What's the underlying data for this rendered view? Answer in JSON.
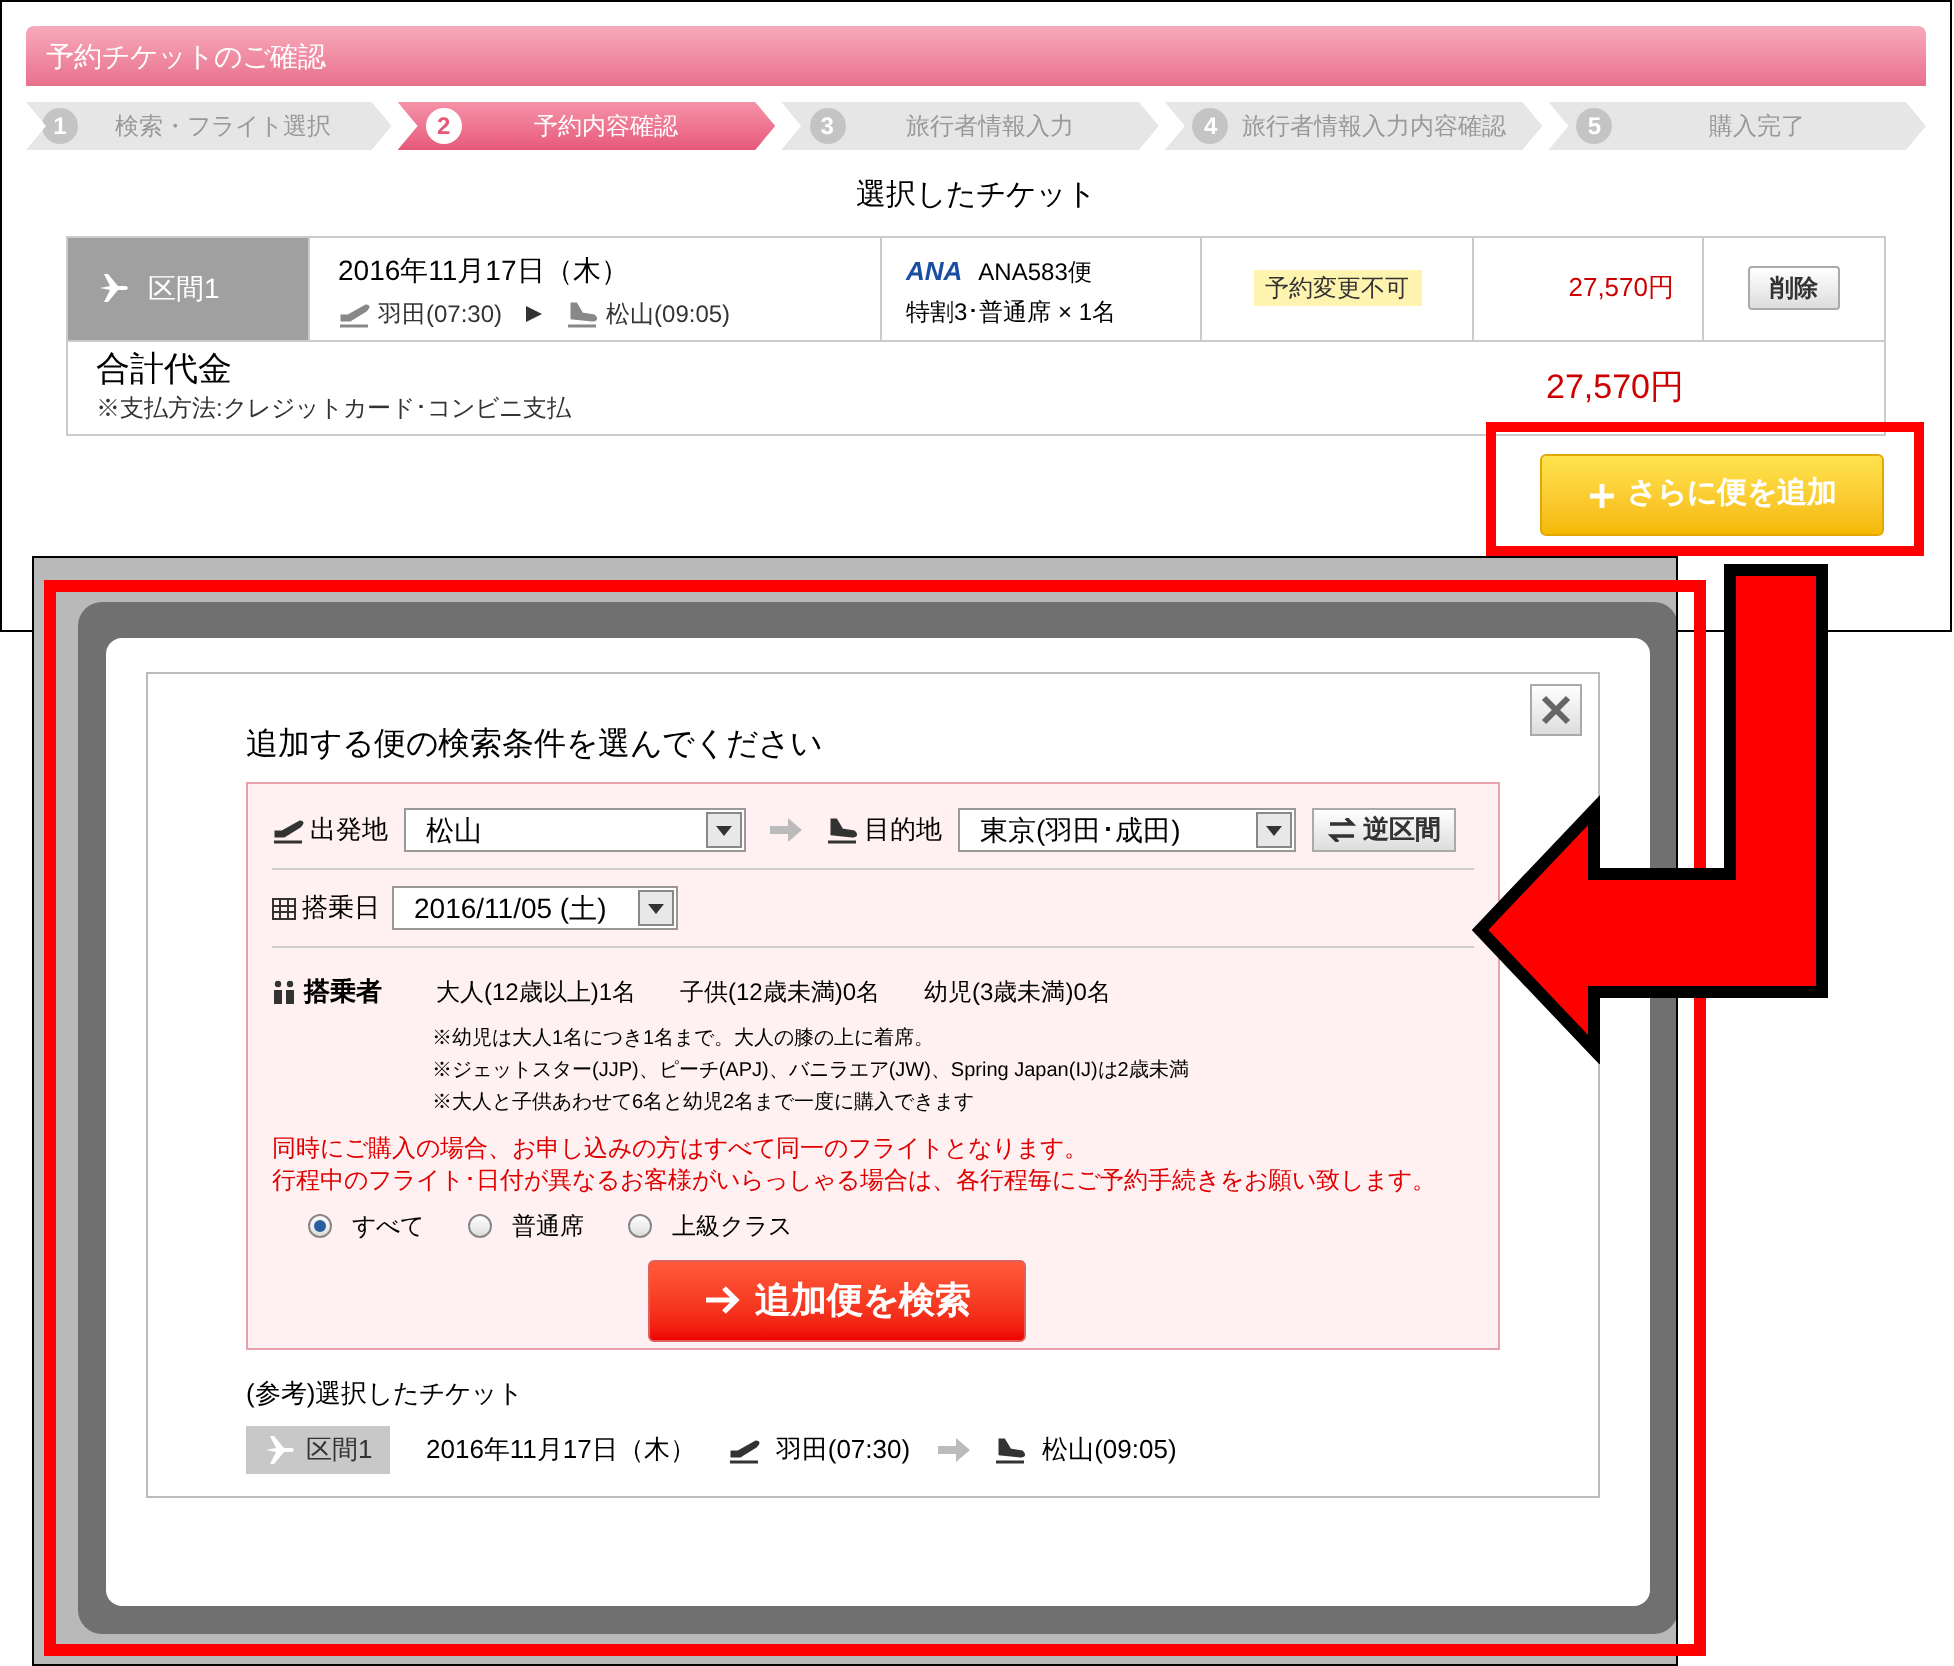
{
  "top_screen": {
    "header": "予約チケットのご確認",
    "steps": [
      {
        "number": "1",
        "label": "検索・フライト選択",
        "selected": false
      },
      {
        "number": "2",
        "label": "予約内容確認",
        "selected": true
      },
      {
        "number": "3",
        "label": "旅行者情報入力",
        "selected": false
      },
      {
        "number": "4",
        "label": "旅行者情報入力内容確認",
        "selected": false
      },
      {
        "number": "5",
        "label": "購入完了",
        "selected": false
      }
    ],
    "section_title": "選択したチケット",
    "ticket": {
      "segment": "区間1",
      "date": "2016年11月17日（木）",
      "departure": "羽田(07:30)",
      "arrival": "松山(09:05)",
      "airline_logo": "ANA",
      "flight": "ANA583便",
      "fare": "特割3･普通席 × 1名",
      "badge": "予約変更不可",
      "price": "27,570円",
      "delete_button": "削除"
    },
    "total": {
      "label": "合計代金",
      "note": "※支払方法:クレジットカード･コンビニ支払",
      "price": "27,570円"
    },
    "add_button": "さらに便を追加"
  },
  "modal": {
    "title": "追加する便の検索条件を選んでください",
    "origin_label": "出発地",
    "origin": "松山",
    "destination_label": "目的地",
    "destination": "東京(羽田･成田)",
    "swap_button": "逆区間",
    "date_label": "搭乗日",
    "date": "2016/11/05 (土)",
    "passengers_label": "搭乗者",
    "passengers": [
      "大人(12歳以上)1名",
      "子供(12歳未満)0名",
      "幼児(3歳未満)0名"
    ],
    "notes": [
      "※幼児は大人1名につき1名まで。大人の膝の上に着席。",
      "※ジェットスター(JJP)、ピーチ(APJ)、バニラエア(JW)、Spring Japan(IJ)は2歳未満",
      "※大人と子供あわせて6名と幼児2名まで一度に購入できます"
    ],
    "warnings": [
      "同時にご購入の場合、お申し込みの方はすべて同一のフライトとなります。",
      "行程中のフライト･日付が異なるお客様がいらっしゃる場合は、各行程毎にご予約手続きをお願い致します。"
    ],
    "cabin_options": [
      {
        "label": "すべて",
        "selected": true
      },
      {
        "label": "普通席",
        "selected": false
      },
      {
        "label": "上級クラス",
        "selected": false
      }
    ],
    "search_button": "追加便を検索",
    "reference_title": "(参考)選択したチケット",
    "reference": {
      "segment": "区間1",
      "date": "2016年11月17日（木）",
      "departure": "羽田(07:30)",
      "arrival": "松山(09:05)"
    }
  }
}
